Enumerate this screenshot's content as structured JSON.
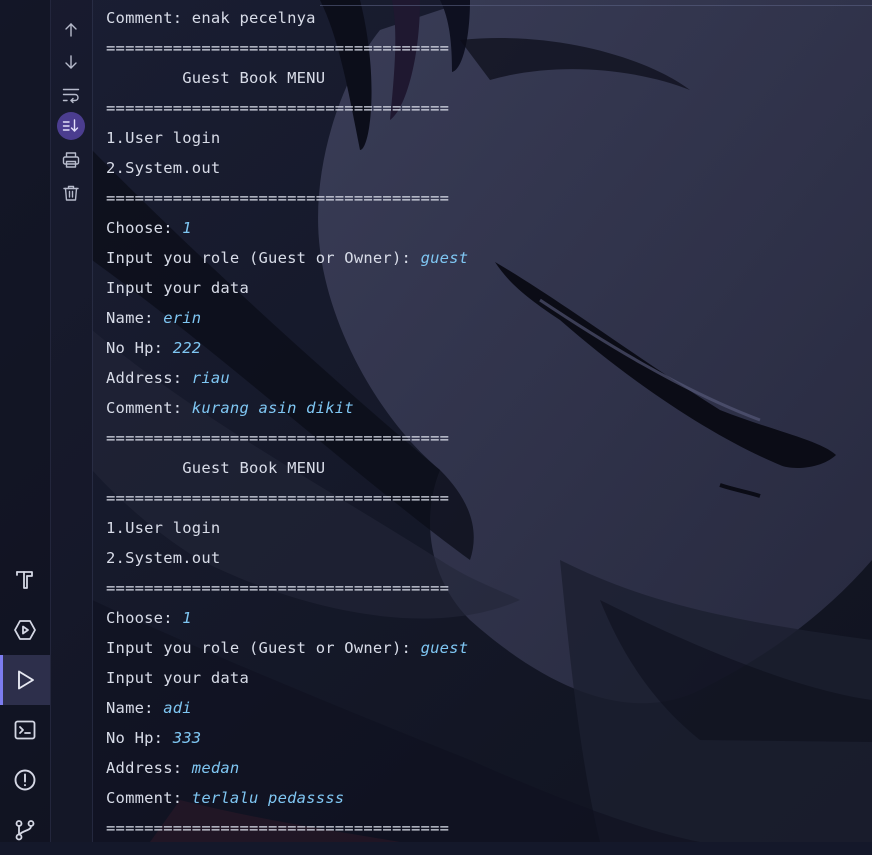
{
  "toolbar": {
    "buttons": [
      {
        "name": "scroll-up-icon"
      },
      {
        "name": "scroll-down-icon"
      },
      {
        "name": "soft-wrap-icon"
      },
      {
        "name": "scroll-to-end-icon",
        "toggled": true
      },
      {
        "name": "print-icon"
      },
      {
        "name": "clear-all-icon"
      }
    ]
  },
  "activity_bar": {
    "items": [
      {
        "name": "build-icon"
      },
      {
        "name": "services-icon"
      },
      {
        "name": "run-icon",
        "active": true
      },
      {
        "name": "terminal-icon"
      },
      {
        "name": "problems-icon"
      },
      {
        "name": "git-icon"
      }
    ]
  },
  "console": {
    "lines": [
      {
        "text": "Comment: enak pecelnya",
        "input": ""
      },
      {
        "text": "====================================",
        "input": ""
      },
      {
        "text": "        Guest Book MENU",
        "input": ""
      },
      {
        "text": "====================================",
        "input": ""
      },
      {
        "text": "1.User login",
        "input": ""
      },
      {
        "text": "2.System.out",
        "input": ""
      },
      {
        "text": "====================================",
        "input": ""
      },
      {
        "text": "Choose: ",
        "input": "1"
      },
      {
        "text": "Input you role (Guest or Owner): ",
        "input": "guest"
      },
      {
        "text": "Input your data",
        "input": ""
      },
      {
        "text": "Name: ",
        "input": "erin"
      },
      {
        "text": "No Hp: ",
        "input": "222"
      },
      {
        "text": "Address: ",
        "input": "riau"
      },
      {
        "text": "Comment: ",
        "input": "kurang asin dikit"
      },
      {
        "text": "====================================",
        "input": ""
      },
      {
        "text": "        Guest Book MENU",
        "input": ""
      },
      {
        "text": "====================================",
        "input": ""
      },
      {
        "text": "1.User login",
        "input": ""
      },
      {
        "text": "2.System.out",
        "input": ""
      },
      {
        "text": "====================================",
        "input": ""
      },
      {
        "text": "Choose: ",
        "input": "1"
      },
      {
        "text": "Input you role (Guest or Owner): ",
        "input": "guest"
      },
      {
        "text": "Input your data",
        "input": ""
      },
      {
        "text": "Name: ",
        "input": "adi"
      },
      {
        "text": "No Hp: ",
        "input": "333"
      },
      {
        "text": "Address: ",
        "input": "medan"
      },
      {
        "text": "Comment: ",
        "input": "terlalu pedassss"
      },
      {
        "text": "====================================",
        "input": ""
      }
    ]
  },
  "colors": {
    "output_text": "#d8dce8",
    "user_input_text": "#7fc6f2",
    "toggle_accent": "#4b3d8f",
    "active_run_indicator": "#7c7cf0"
  }
}
